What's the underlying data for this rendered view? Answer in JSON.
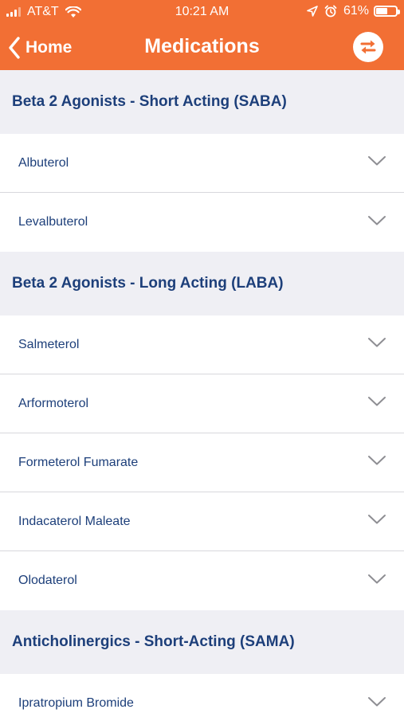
{
  "status_bar": {
    "carrier": "AT&T",
    "time": "10:21 AM",
    "battery_percent": "61%",
    "battery_level": 0.61
  },
  "nav": {
    "back_label": "Home",
    "title": "Medications",
    "swap_icon": "swap-arrows-icon"
  },
  "colors": {
    "header": "#f26f34",
    "text_blue": "#1d3f7a",
    "section_bg": "#efeff4"
  },
  "sections": [
    {
      "title": "Beta 2 Agonists - Short Acting (SABA)",
      "items": [
        "Albuterol",
        "Levalbuterol"
      ]
    },
    {
      "title": "Beta 2 Agonists - Long Acting (LABA)",
      "items": [
        "Salmeterol",
        "Arformoterol",
        "Formeterol Fumarate",
        "Indacaterol Maleate",
        "Olodaterol"
      ]
    },
    {
      "title": "Anticholinergics - Short-Acting (SAMA)",
      "items": [
        "Ipratropium Bromide"
      ]
    }
  ]
}
